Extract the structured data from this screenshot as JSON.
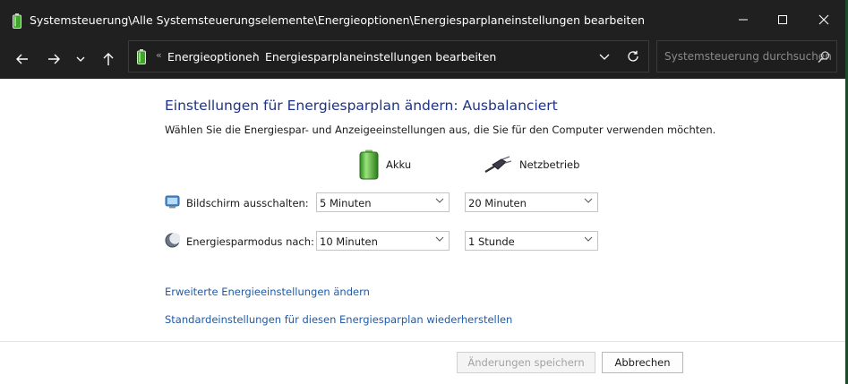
{
  "titlebar": {
    "title": "Systemsteuerung\\Alle Systemsteuerungselemente\\Energieoptionen\\Energiesparplaneinstellungen bearbeiten"
  },
  "navbar": {
    "breadcrumb_overflow": "«",
    "crumbs": [
      "Energieoptionen",
      "Energiesparplaneinstellungen bearbeiten"
    ],
    "search_placeholder": "Systemsteuerung durchsuchen"
  },
  "main": {
    "heading": "Einstellungen für Energiesparplan ändern: Ausbalanciert",
    "subtitle": "Wählen Sie die Energiespar- und Anzeigeeinstellungen aus, die Sie für den Computer verwenden möchten.",
    "columns": {
      "battery": "Akku",
      "plugged_in": "Netzbetrieb"
    },
    "rows": [
      {
        "label": "Bildschirm ausschalten:",
        "battery_value": "5 Minuten",
        "plugged_value": "20 Minuten"
      },
      {
        "label": "Energiesparmodus nach:",
        "battery_value": "10 Minuten",
        "plugged_value": "1 Stunde"
      }
    ],
    "links": {
      "advanced": "Erweiterte Energieeinstellungen ändern",
      "restore": "Standardeinstellungen für diesen Energiesparplan wiederherstellen"
    }
  },
  "footer": {
    "save_label": "Änderungen speichern",
    "cancel_label": "Abbrechen"
  },
  "colors": {
    "heading": "#1e3287",
    "link": "#1f5ba8",
    "titlebar_bg": "#202020",
    "battery_green": "#3fa629"
  }
}
